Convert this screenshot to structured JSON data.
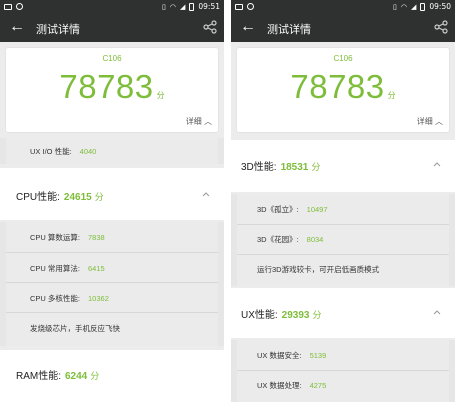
{
  "status_left": {
    "time": "09:51"
  },
  "status_right": {
    "time": "09:50"
  },
  "app_title": "测试详情",
  "card": {
    "device": "C106",
    "score": "78783",
    "unit": "分",
    "detail": "详细"
  },
  "left": {
    "ux_io": {
      "label": "UX I/O 性能:",
      "value": "4040"
    },
    "cpu": {
      "label": "CPU性能:",
      "value": "24615",
      "unit": "分"
    },
    "cpu_items": [
      {
        "label": "CPU 算数运算:",
        "value": "7838"
      },
      {
        "label": "CPU 常用算法:",
        "value": "6415"
      },
      {
        "label": "CPU 多核性能:",
        "value": "10362"
      }
    ],
    "cpu_note": "发烧级芯片，手机反应飞快",
    "ram": {
      "label": "RAM性能:",
      "value": "6244",
      "unit": "分"
    }
  },
  "right": {
    "gpu": {
      "label": "3D性能:",
      "value": "18531",
      "unit": "分"
    },
    "gpu_items": [
      {
        "label": "3D《孤立》:",
        "value": "10497"
      },
      {
        "label": "3D《花园》:",
        "value": "8034"
      }
    ],
    "gpu_note": "运行3D游戏较卡，可开启低画质模式",
    "ux": {
      "label": "UX性能:",
      "value": "29393",
      "unit": "分"
    },
    "ux_items": [
      {
        "label": "UX 数据安全:",
        "value": "5139"
      },
      {
        "label": "UX 数据处理:",
        "value": "4275"
      }
    ]
  },
  "colors": {
    "accent": "#7dbd3a",
    "bar": "#2f3030"
  }
}
